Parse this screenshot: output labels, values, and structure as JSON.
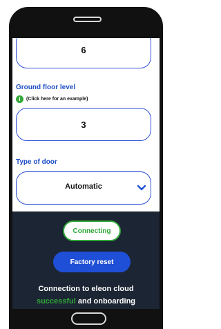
{
  "fields": {
    "top_value": "6",
    "ground_floor_label": "Ground floor level",
    "ground_floor_hint": "(Click here for an example)",
    "ground_floor_value": "3",
    "door_label": "Type of door",
    "door_value": "Automatic"
  },
  "actions": {
    "connecting_label": "Connecting",
    "factory_reset_label": "Factory reset"
  },
  "status": {
    "line1": "Connection to eleon cloud",
    "success_word": "successful",
    "rest": " and onboarding"
  },
  "colors": {
    "accent_blue": "#1f4fd6",
    "success_green": "#2fa637",
    "panel_dark": "#1c2533"
  },
  "icons": {
    "info": "info-icon",
    "dropdown": "chevron-down-icon"
  }
}
